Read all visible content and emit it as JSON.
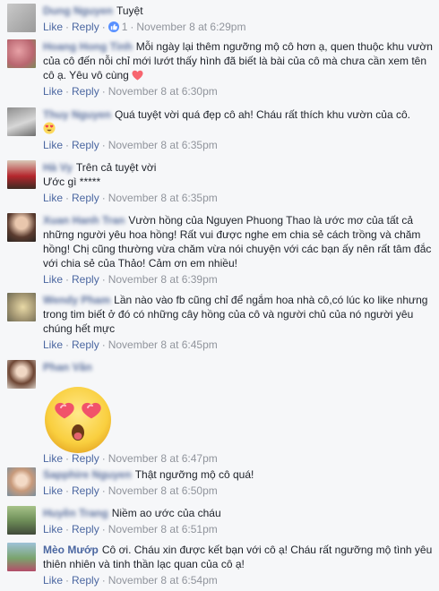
{
  "actions": {
    "like": "Like",
    "reply": "Reply",
    "sep": "·"
  },
  "comments": [
    {
      "name": "Dung Nguyen",
      "text": "Tuyệt",
      "likes": "1",
      "time": "November 8 at 6:29pm"
    },
    {
      "name": "Hoang Hong Tinh",
      "text": "Mỗi ngày lại thêm ngưỡng mộ cô hơn ạ, quen thuộc khu vườn của cô đến nỗi chỉ mới lướt thấy hình đã biết là bài của cô mà chưa cần xem tên cô ạ. Yêu vô cùng",
      "time": "November 8 at 6:30pm"
    },
    {
      "name": "Thuy Nguyen",
      "text": "Quá tuyệt vời quá đẹp cô ah! Cháu rất thích khu vườn của cô.",
      "time": "November 8 at 6:35pm"
    },
    {
      "name": "Hà Vy",
      "text_line1": "Trên cả tuyệt vời",
      "text_line2": "Ước gì *****",
      "time": "November 8 at 6:35pm"
    },
    {
      "name": "Xuan Hanh Tran",
      "text": "Vườn hồng của Nguyen Phuong Thao là ước mơ của tất cả những người yêu hoa hồng! Rất vui được nghe em chia sẻ cách trồng và chăm hồng! Chị cũng thường vừa chăm vừa nói chuyện với các bạn ấy nên rất tâm đắc với chia sẻ của Thảo! Cảm ơn em nhiều!",
      "time": "November 8 at 6:39pm"
    },
    {
      "name": "Wendy Pham",
      "text": "Lần nào vào fb cũng chỉ để ngắm hoa nhà cô,có lúc ko like nhưng trong tim biết ở đó có những cây hồng của cô và người chủ của nó người yêu chúng hết mực",
      "time": "November 8 at 6:45pm"
    },
    {
      "name": "Phan Vân",
      "time": "November 8 at 6:47pm"
    },
    {
      "name": "Sapphire Nguyen",
      "text": "Thật ngưỡng mộ cô quá!",
      "time": "November 8 at 6:50pm"
    },
    {
      "name": "Huyền Trang",
      "text": "Niềm ao ước của cháu",
      "time": "November 8 at 6:51pm"
    },
    {
      "name": "Mèo Mướp",
      "text": "Cô ơi. Cháu xin được kết bạn với cô ạ! Cháu rất ngưỡng mộ tình yêu thiên nhiên và tinh thần lạc quan của cô ạ!",
      "time": "November 8 at 6:54pm"
    }
  ],
  "colors": {
    "link": "#4b67a1",
    "meta": "#90949c",
    "like_badge": "#5890ff",
    "heart": "#f7656f"
  },
  "icons": [
    "like-badge-icon",
    "heart-icon",
    "heart-eyes-emoji-icon"
  ]
}
